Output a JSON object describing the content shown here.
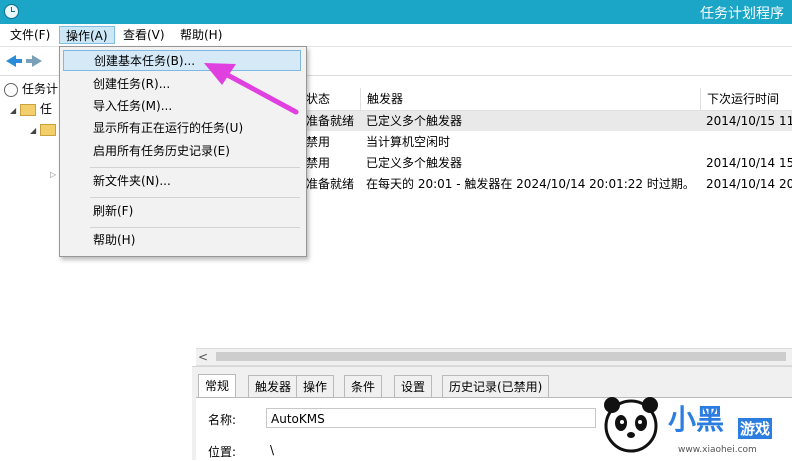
{
  "window": {
    "title": "任务计划程序"
  },
  "menubar": {
    "items": [
      {
        "label": "文件(F)"
      },
      {
        "label": "操作(A)"
      },
      {
        "label": "查看(V)"
      },
      {
        "label": "帮助(H)"
      }
    ]
  },
  "dropdown": {
    "items": [
      {
        "label": "创建基本任务(B)..."
      },
      {
        "label": "创建任务(R)..."
      },
      {
        "label": "导入任务(M)..."
      },
      {
        "label": "显示所有正在运行的任务(U)"
      },
      {
        "label": "启用所有任务历史记录(E)"
      },
      {
        "label": "新文件夹(N)..."
      },
      {
        "label": "刷新(F)"
      },
      {
        "label": "帮助(H)"
      }
    ]
  },
  "tree": {
    "root_label": "任务计",
    "child_label": "任"
  },
  "grid": {
    "columns": [
      "状态",
      "触发器",
      "下次运行时间"
    ],
    "rows": [
      {
        "status": "准备就绪",
        "trigger": "已定义多个触发器",
        "next": "2014/10/15 11"
      },
      {
        "status": "禁用",
        "trigger": "当计算机空闲时",
        "next": ""
      },
      {
        "status": "禁用",
        "trigger": "已定义多个触发器",
        "next": "2014/10/14 15"
      },
      {
        "status": "准备就绪",
        "trigger": "在每天的 20:01 - 触发器在 2024/10/14 20:01:22 时过期。",
        "next": "2014/10/14 20"
      }
    ]
  },
  "detail": {
    "tabs": [
      "常规",
      "触发器",
      "操作",
      "条件",
      "设置",
      "历史记录(已禁用)"
    ],
    "name_label": "名称:",
    "name_value": "AutoKMS",
    "location_label": "位置:",
    "location_value": "\\"
  },
  "watermark": {
    "text_main": "小黑",
    "text_sub": "游戏",
    "url": "www.xiaohei.com"
  },
  "colors": {
    "titlebar": "#1ba6c8",
    "menu_highlight": "#d5e9f7",
    "annotation_arrow": "#e040e0"
  }
}
